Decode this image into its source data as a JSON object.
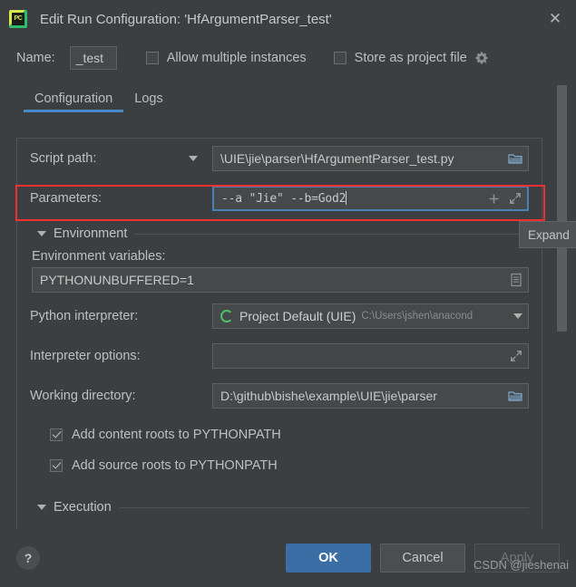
{
  "window": {
    "title": "Edit Run Configuration: 'HfArgumentParser_test'",
    "app_icon": "pycharm-icon",
    "close_label": "✕"
  },
  "name_row": {
    "label": "Name:",
    "value": "_test",
    "allow_multiple_instances": {
      "label": "Allow multiple instances",
      "checked": false
    },
    "store_as_project_file": {
      "label": "Store as project file",
      "checked": false
    },
    "gear_icon": "gear-icon"
  },
  "tabs": [
    {
      "label": "Configuration",
      "active": true
    },
    {
      "label": "Logs",
      "active": false
    }
  ],
  "form": {
    "script_path": {
      "label": "Script path:",
      "value": "\\UIE\\jie\\parser\\HfArgumentParser_test.py",
      "browse_icon": "folder-icon",
      "dropdown_icon": "chevron-down-icon"
    },
    "parameters": {
      "label": "Parameters:",
      "value": "--a \"Jie\" --b=God2",
      "insert_macro_icon": "plus-icon",
      "expand_icon": "expand-icon"
    },
    "environment_section": {
      "title": "Environment",
      "collapse_icon": "triangle-down-icon"
    },
    "environment_variables": {
      "label": "Environment variables:",
      "value": "PYTHONUNBUFFERED=1",
      "edit_icon": "list-edit-icon"
    },
    "python_interpreter": {
      "label": "Python interpreter:",
      "value": "Project Default (UIE)",
      "path_hint": "C:\\Users\\jshen\\anacond",
      "status_icon": "python-env-icon",
      "dropdown_icon": "chevron-down-icon"
    },
    "interpreter_options": {
      "label": "Interpreter options:",
      "value": "",
      "expand_icon": "expand-icon"
    },
    "working_directory": {
      "label": "Working directory:",
      "value": "D:\\github\\bishe\\example\\UIE\\jie\\parser",
      "browse_icon": "folder-icon"
    },
    "add_content_roots": {
      "label": "Add content roots to PYTHONPATH",
      "checked": true
    },
    "add_source_roots": {
      "label": "Add source roots to PYTHONPATH",
      "checked": true
    },
    "execution_section": {
      "title": "Execution",
      "collapse_icon": "triangle-down-icon"
    }
  },
  "tooltip": {
    "text": "Expand"
  },
  "footer": {
    "help_label": "?",
    "ok_label": "OK",
    "cancel_label": "Cancel",
    "apply_label": "Apply"
  },
  "watermark": {
    "text": "CSDN @jieshenai"
  },
  "colors": {
    "dialog_bg": "#3c3f41",
    "field_bg": "#45494a",
    "accent_blue": "#4a88c7",
    "primary_button": "#3b6ea5",
    "highlight_red": "#f03030",
    "focus_border": "#4b80b5",
    "text": "#bbbbbb"
  }
}
